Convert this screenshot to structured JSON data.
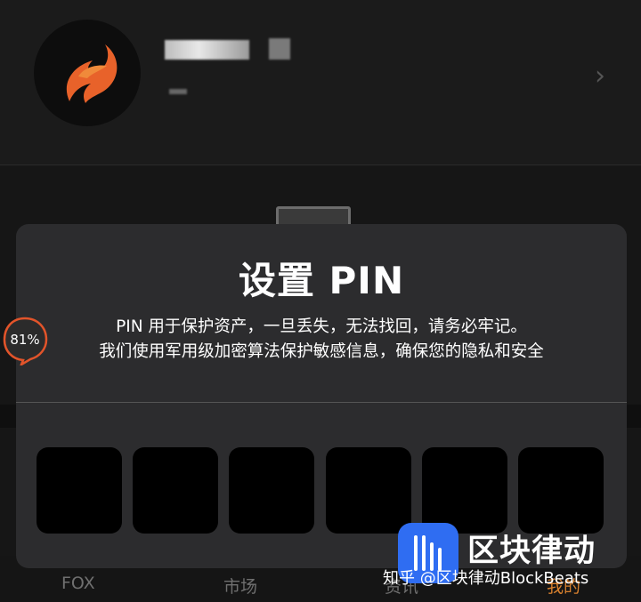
{
  "profile": {
    "chevron": "›"
  },
  "modal": {
    "title": "设置 PIN",
    "desc_line1": "PIN 用于保护资产，一旦丢失，无法找回，请务必牢记。",
    "desc_line2": "我们使用军用级加密算法保护敏感信息，确保您的隐私和安全",
    "pin_count": 6
  },
  "badge": {
    "text": "81%"
  },
  "tabs": [
    {
      "label": "FOX",
      "active": false
    },
    {
      "label": "市场",
      "active": false
    },
    {
      "label": "资讯",
      "active": false
    },
    {
      "label": "我的",
      "active": true
    }
  ],
  "watermark": {
    "brand": "区块律动",
    "handle": "知乎 @区块律动BlockBeats"
  },
  "colors": {
    "accent": "#d7802e",
    "modal_bg": "#2c2c2e",
    "watermark_blue": "#2f6df2"
  }
}
